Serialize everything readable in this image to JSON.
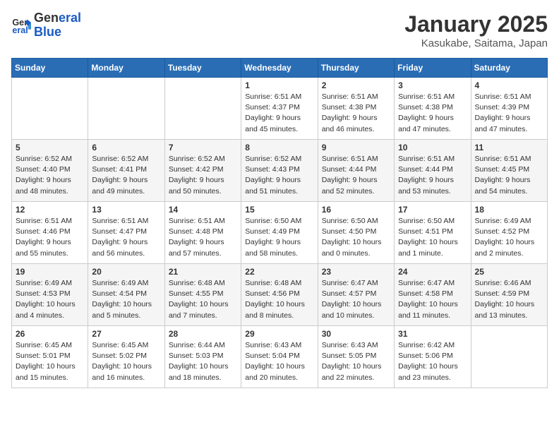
{
  "logo": {
    "line1": "General",
    "line2": "Blue"
  },
  "title": "January 2025",
  "subtitle": "Kasukabe, Saitama, Japan",
  "days_of_week": [
    "Sunday",
    "Monday",
    "Tuesday",
    "Wednesday",
    "Thursday",
    "Friday",
    "Saturday"
  ],
  "weeks": [
    [
      {
        "day": "",
        "info": ""
      },
      {
        "day": "",
        "info": ""
      },
      {
        "day": "",
        "info": ""
      },
      {
        "day": "1",
        "info": "Sunrise: 6:51 AM\nSunset: 4:37 PM\nDaylight: 9 hours\nand 45 minutes."
      },
      {
        "day": "2",
        "info": "Sunrise: 6:51 AM\nSunset: 4:38 PM\nDaylight: 9 hours\nand 46 minutes."
      },
      {
        "day": "3",
        "info": "Sunrise: 6:51 AM\nSunset: 4:38 PM\nDaylight: 9 hours\nand 47 minutes."
      },
      {
        "day": "4",
        "info": "Sunrise: 6:51 AM\nSunset: 4:39 PM\nDaylight: 9 hours\nand 47 minutes."
      }
    ],
    [
      {
        "day": "5",
        "info": "Sunrise: 6:52 AM\nSunset: 4:40 PM\nDaylight: 9 hours\nand 48 minutes."
      },
      {
        "day": "6",
        "info": "Sunrise: 6:52 AM\nSunset: 4:41 PM\nDaylight: 9 hours\nand 49 minutes."
      },
      {
        "day": "7",
        "info": "Sunrise: 6:52 AM\nSunset: 4:42 PM\nDaylight: 9 hours\nand 50 minutes."
      },
      {
        "day": "8",
        "info": "Sunrise: 6:52 AM\nSunset: 4:43 PM\nDaylight: 9 hours\nand 51 minutes."
      },
      {
        "day": "9",
        "info": "Sunrise: 6:51 AM\nSunset: 4:44 PM\nDaylight: 9 hours\nand 52 minutes."
      },
      {
        "day": "10",
        "info": "Sunrise: 6:51 AM\nSunset: 4:44 PM\nDaylight: 9 hours\nand 53 minutes."
      },
      {
        "day": "11",
        "info": "Sunrise: 6:51 AM\nSunset: 4:45 PM\nDaylight: 9 hours\nand 54 minutes."
      }
    ],
    [
      {
        "day": "12",
        "info": "Sunrise: 6:51 AM\nSunset: 4:46 PM\nDaylight: 9 hours\nand 55 minutes."
      },
      {
        "day": "13",
        "info": "Sunrise: 6:51 AM\nSunset: 4:47 PM\nDaylight: 9 hours\nand 56 minutes."
      },
      {
        "day": "14",
        "info": "Sunrise: 6:51 AM\nSunset: 4:48 PM\nDaylight: 9 hours\nand 57 minutes."
      },
      {
        "day": "15",
        "info": "Sunrise: 6:50 AM\nSunset: 4:49 PM\nDaylight: 9 hours\nand 58 minutes."
      },
      {
        "day": "16",
        "info": "Sunrise: 6:50 AM\nSunset: 4:50 PM\nDaylight: 10 hours\nand 0 minutes."
      },
      {
        "day": "17",
        "info": "Sunrise: 6:50 AM\nSunset: 4:51 PM\nDaylight: 10 hours\nand 1 minute."
      },
      {
        "day": "18",
        "info": "Sunrise: 6:49 AM\nSunset: 4:52 PM\nDaylight: 10 hours\nand 2 minutes."
      }
    ],
    [
      {
        "day": "19",
        "info": "Sunrise: 6:49 AM\nSunset: 4:53 PM\nDaylight: 10 hours\nand 4 minutes."
      },
      {
        "day": "20",
        "info": "Sunrise: 6:49 AM\nSunset: 4:54 PM\nDaylight: 10 hours\nand 5 minutes."
      },
      {
        "day": "21",
        "info": "Sunrise: 6:48 AM\nSunset: 4:55 PM\nDaylight: 10 hours\nand 7 minutes."
      },
      {
        "day": "22",
        "info": "Sunrise: 6:48 AM\nSunset: 4:56 PM\nDaylight: 10 hours\nand 8 minutes."
      },
      {
        "day": "23",
        "info": "Sunrise: 6:47 AM\nSunset: 4:57 PM\nDaylight: 10 hours\nand 10 minutes."
      },
      {
        "day": "24",
        "info": "Sunrise: 6:47 AM\nSunset: 4:58 PM\nDaylight: 10 hours\nand 11 minutes."
      },
      {
        "day": "25",
        "info": "Sunrise: 6:46 AM\nSunset: 4:59 PM\nDaylight: 10 hours\nand 13 minutes."
      }
    ],
    [
      {
        "day": "26",
        "info": "Sunrise: 6:45 AM\nSunset: 5:01 PM\nDaylight: 10 hours\nand 15 minutes."
      },
      {
        "day": "27",
        "info": "Sunrise: 6:45 AM\nSunset: 5:02 PM\nDaylight: 10 hours\nand 16 minutes."
      },
      {
        "day": "28",
        "info": "Sunrise: 6:44 AM\nSunset: 5:03 PM\nDaylight: 10 hours\nand 18 minutes."
      },
      {
        "day": "29",
        "info": "Sunrise: 6:43 AM\nSunset: 5:04 PM\nDaylight: 10 hours\nand 20 minutes."
      },
      {
        "day": "30",
        "info": "Sunrise: 6:43 AM\nSunset: 5:05 PM\nDaylight: 10 hours\nand 22 minutes."
      },
      {
        "day": "31",
        "info": "Sunrise: 6:42 AM\nSunset: 5:06 PM\nDaylight: 10 hours\nand 23 minutes."
      },
      {
        "day": "",
        "info": ""
      }
    ]
  ]
}
